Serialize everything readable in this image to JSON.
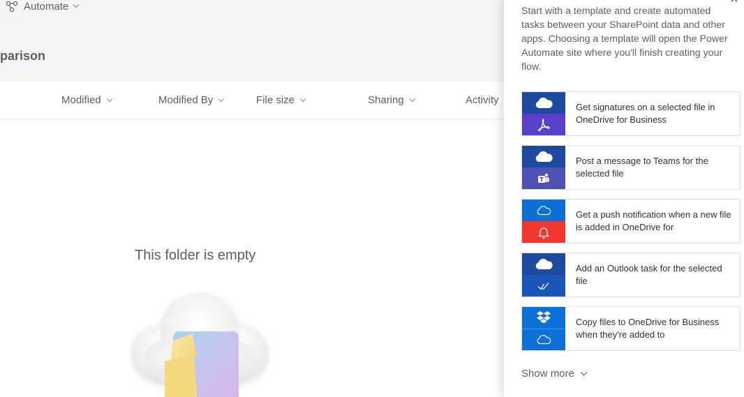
{
  "toolbar": {
    "automate_label": "Automate"
  },
  "page": {
    "title": "parison"
  },
  "columns": [
    {
      "label": "Modified"
    },
    {
      "label": "Modified By"
    },
    {
      "label": "File size"
    },
    {
      "label": "Sharing"
    },
    {
      "label": "Activity"
    }
  ],
  "empty_state": {
    "title": "This folder is empty"
  },
  "panel": {
    "description": "Start with a template and create automated tasks between your SharePoint data and other apps. Choosing a template will open the Power Automate site where you'll finish creating your flow.",
    "templates": [
      {
        "label": "Get signatures on a selected file in OneDrive for Business",
        "top_icon": "onedrive-icon",
        "bottom_icon": "adobe-sign-icon",
        "top_color": "#1e4a9e",
        "bottom_color": "#5b3fc8"
      },
      {
        "label": "Post a message to Teams for the selected file",
        "top_icon": "onedrive-icon",
        "bottom_icon": "teams-icon",
        "top_color": "#1e4a9e",
        "bottom_color": "#4f52b2"
      },
      {
        "label": "Get a push notification when a new file is added in OneDrive for",
        "top_icon": "onedrive-icon",
        "bottom_icon": "bell-icon",
        "top_color": "#0b6fd4",
        "bottom_color": "#f2372f"
      },
      {
        "label": "Add an Outlook task for the selected file",
        "top_icon": "onedrive-icon",
        "bottom_icon": "task-check-icon",
        "top_color": "#1e4a9e",
        "bottom_color": "#1b55b8"
      },
      {
        "label": "Copy files to OneDrive for Business when they're added to",
        "top_icon": "dropbox-icon",
        "bottom_icon": "onedrive-icon",
        "top_color": "#0d70d9",
        "bottom_color": "#0d70d9"
      }
    ],
    "show_more_label": "Show more"
  }
}
